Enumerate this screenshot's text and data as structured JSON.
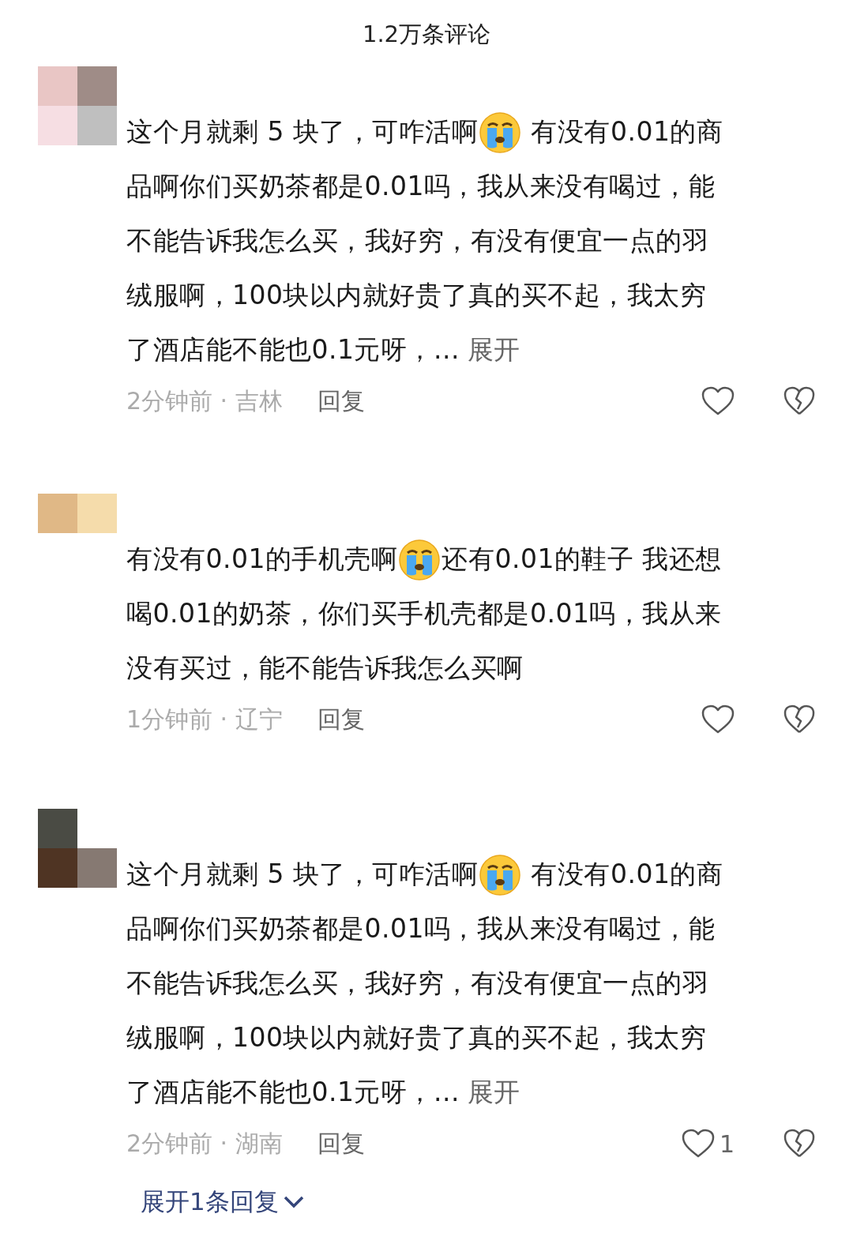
{
  "header": {
    "title": "1.2万条评论"
  },
  "comments": [
    {
      "lines": [
        [
          {
            "kind": "text",
            "text": "这个月就剩 5 块了，可咋活啊"
          },
          {
            "kind": "emoji"
          },
          {
            "kind": "text",
            "text": " 有没有0.01的商"
          }
        ],
        [
          {
            "kind": "text",
            "text": "品啊你们买奶茶都是0.01吗，我从来没有喝过，能"
          }
        ],
        [
          {
            "kind": "text",
            "text": "不能告诉我怎么买，我好穷，有没有便宜一点的羽"
          }
        ],
        [
          {
            "kind": "text",
            "text": "绒服啊，100块以内就好贵了真的买不起，我太穷"
          }
        ],
        [
          {
            "kind": "text",
            "text": "了酒店能不能也0.1元呀，..."
          }
        ]
      ],
      "expand": "展开",
      "meta": "2分钟前 · 吉林",
      "reply": "回复"
    },
    {
      "lines": [
        [
          {
            "kind": "text",
            "text": "有没有0.01的手机壳啊"
          },
          {
            "kind": "emoji"
          },
          {
            "kind": "text",
            "text": "还有0.01的鞋子 我还想"
          }
        ],
        [
          {
            "kind": "text",
            "text": "喝0.01的奶茶，你们买手机壳都是0.01吗，我从来"
          }
        ],
        [
          {
            "kind": "text",
            "text": "没有买过，能不能告诉我怎么买啊"
          }
        ]
      ],
      "meta": "1分钟前 · 辽宁",
      "reply": "回复"
    },
    {
      "lines": [
        [
          {
            "kind": "text",
            "text": "这个月就剩 5 块了，可咋活啊"
          },
          {
            "kind": "emoji"
          },
          {
            "kind": "text",
            "text": " 有没有0.01的商"
          }
        ],
        [
          {
            "kind": "text",
            "text": "品啊你们买奶茶都是0.01吗，我从来没有喝过，能"
          }
        ],
        [
          {
            "kind": "text",
            "text": "不能告诉我怎么买，我好穷，有没有便宜一点的羽"
          }
        ],
        [
          {
            "kind": "text",
            "text": "绒服啊，100块以内就好贵了真的买不起，我太穷"
          }
        ],
        [
          {
            "kind": "text",
            "text": "了酒店能不能也0.1元呀，..."
          }
        ]
      ],
      "expand": "展开",
      "meta": "2分钟前 · 湖南",
      "reply": "回复",
      "likes": "1",
      "more_replies": "展开1条回复"
    }
  ]
}
